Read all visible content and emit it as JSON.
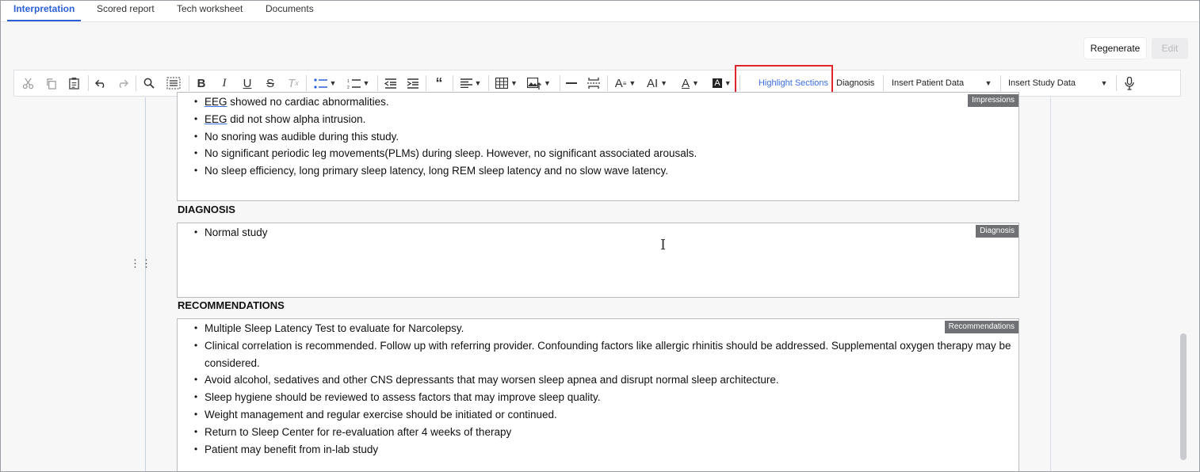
{
  "tabs": [
    {
      "label": "Interpretation",
      "active": true
    },
    {
      "label": "Scored report",
      "active": false
    },
    {
      "label": "Tech worksheet",
      "active": false
    },
    {
      "label": "Documents",
      "active": false
    }
  ],
  "actions": {
    "regenerate_label": "Regenerate",
    "edit_label": "Edit"
  },
  "toolbar": {
    "icons": [
      "cut-icon",
      "copy-icon",
      "paste-icon",
      "undo-icon",
      "redo-icon",
      "find-replace-icon",
      "select-all-icon",
      "bold-icon",
      "italic-icon",
      "underline-icon",
      "strikethrough-icon",
      "remove-format-icon",
      "bulleted-list-icon",
      "numbered-list-icon",
      "outdent-icon",
      "indent-icon",
      "blockquote-icon",
      "align-icon",
      "table-icon",
      "insert-image-icon",
      "horizontal-line-icon",
      "page-break-icon",
      "font-size-icon",
      "font-family-icon",
      "font-color-icon",
      "background-color-icon",
      "microphone-icon"
    ],
    "highlight_sections_label": "Highlight Sections",
    "diagnosis_label": "Diagnosis",
    "insert_patient_data_label": "Insert Patient Data",
    "insert_study_data_label": "Insert Study Data"
  },
  "impressions": {
    "tag": "Impressions",
    "items": [
      {
        "prefix": "EEG",
        "text": " showed no cardiac abnormalities."
      },
      {
        "prefix": "EEG",
        "text": " did not show alpha intrusion."
      },
      {
        "prefix": "",
        "text": "No snoring was audible during this study."
      },
      {
        "prefix": "",
        "text": "No significant periodic leg movements(PLMs) during sleep. However, no significant associated arousals."
      },
      {
        "prefix": "",
        "text": "No sleep efficiency, long primary sleep latency, long REM sleep latency and no slow wave latency."
      }
    ]
  },
  "diagnosis": {
    "heading": "DIAGNOSIS",
    "tag": "Diagnosis",
    "items": [
      "Normal study"
    ]
  },
  "recommendations": {
    "heading": "RECOMMENDATIONS",
    "tag": "Recommendations",
    "items": [
      "Multiple Sleep Latency Test to evaluate for Narcolepsy.",
      "Clinical correlation is recommended. Follow up with referring provider. Confounding factors like allergic rhinitis should be addressed. Supplemental oxygen therapy may be considered.",
      "Avoid alcohol, sedatives and other CNS depressants that may worsen sleep apnea and disrupt normal sleep architecture.",
      "Sleep hygiene should be reviewed to assess factors that may improve sleep quality.",
      "Weight management and regular exercise should be initiated or continued.",
      "Return to Sleep Center for re-evaluation after 4 weeks of therapy",
      "Patient may benefit from in-lab study"
    ]
  },
  "colors": {
    "accent": "#2a5fd6",
    "highlight_box": "#e0262a",
    "tag_bg": "#6f7174"
  }
}
